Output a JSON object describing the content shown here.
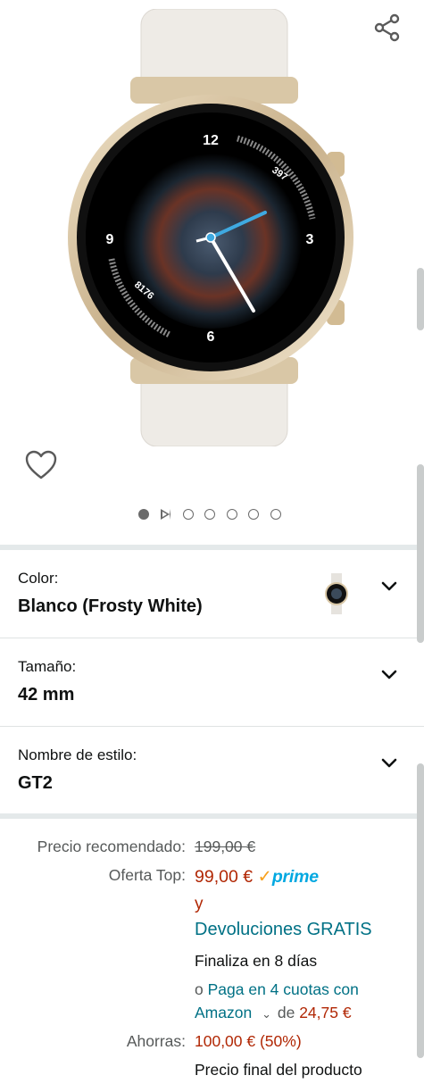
{
  "variations": [
    {
      "label": "Color:",
      "value": "Blanco (Frosty White)"
    },
    {
      "label": "Tamaño:",
      "value": "42 mm"
    },
    {
      "label": "Nombre de estilo:",
      "value": "GT2"
    }
  ],
  "watch_face": {
    "hour_12": "12",
    "hour_3": "3",
    "hour_6": "6",
    "hour_9": "9",
    "stat_top": "397",
    "stat_bottom": "8176"
  },
  "image_carousel": {
    "count": 7,
    "active_index": 0
  },
  "pricing": {
    "list_label": "Precio recomendado:",
    "list_price": "199,00 €",
    "deal_label": "Oferta Top:",
    "deal_price": "99,00 €",
    "prime_check": "✓",
    "prime_text": "prime",
    "and_text": "y",
    "returns_text": "Devoluciones GRATIS",
    "deal_ends": "Finaliza en 8 días",
    "installments_prefix": "o",
    "installments_link": "Paga en 4 cuotas con",
    "installments_link_2": "Amazon",
    "installments_of": "de",
    "installments_amount": "24,75 €",
    "savings_label": "Ahorras:",
    "savings_value": "100,00 € (50%)",
    "final_price_note": "Precio final del producto"
  },
  "colors": {
    "price_red": "#b12704",
    "link_teal": "#007185",
    "prime_blue": "#00a8e1",
    "separator": "#e4e9ea"
  },
  "icons": {
    "share": "share-icon",
    "wishlist": "heart-icon",
    "expand": "chevron-down-icon"
  }
}
